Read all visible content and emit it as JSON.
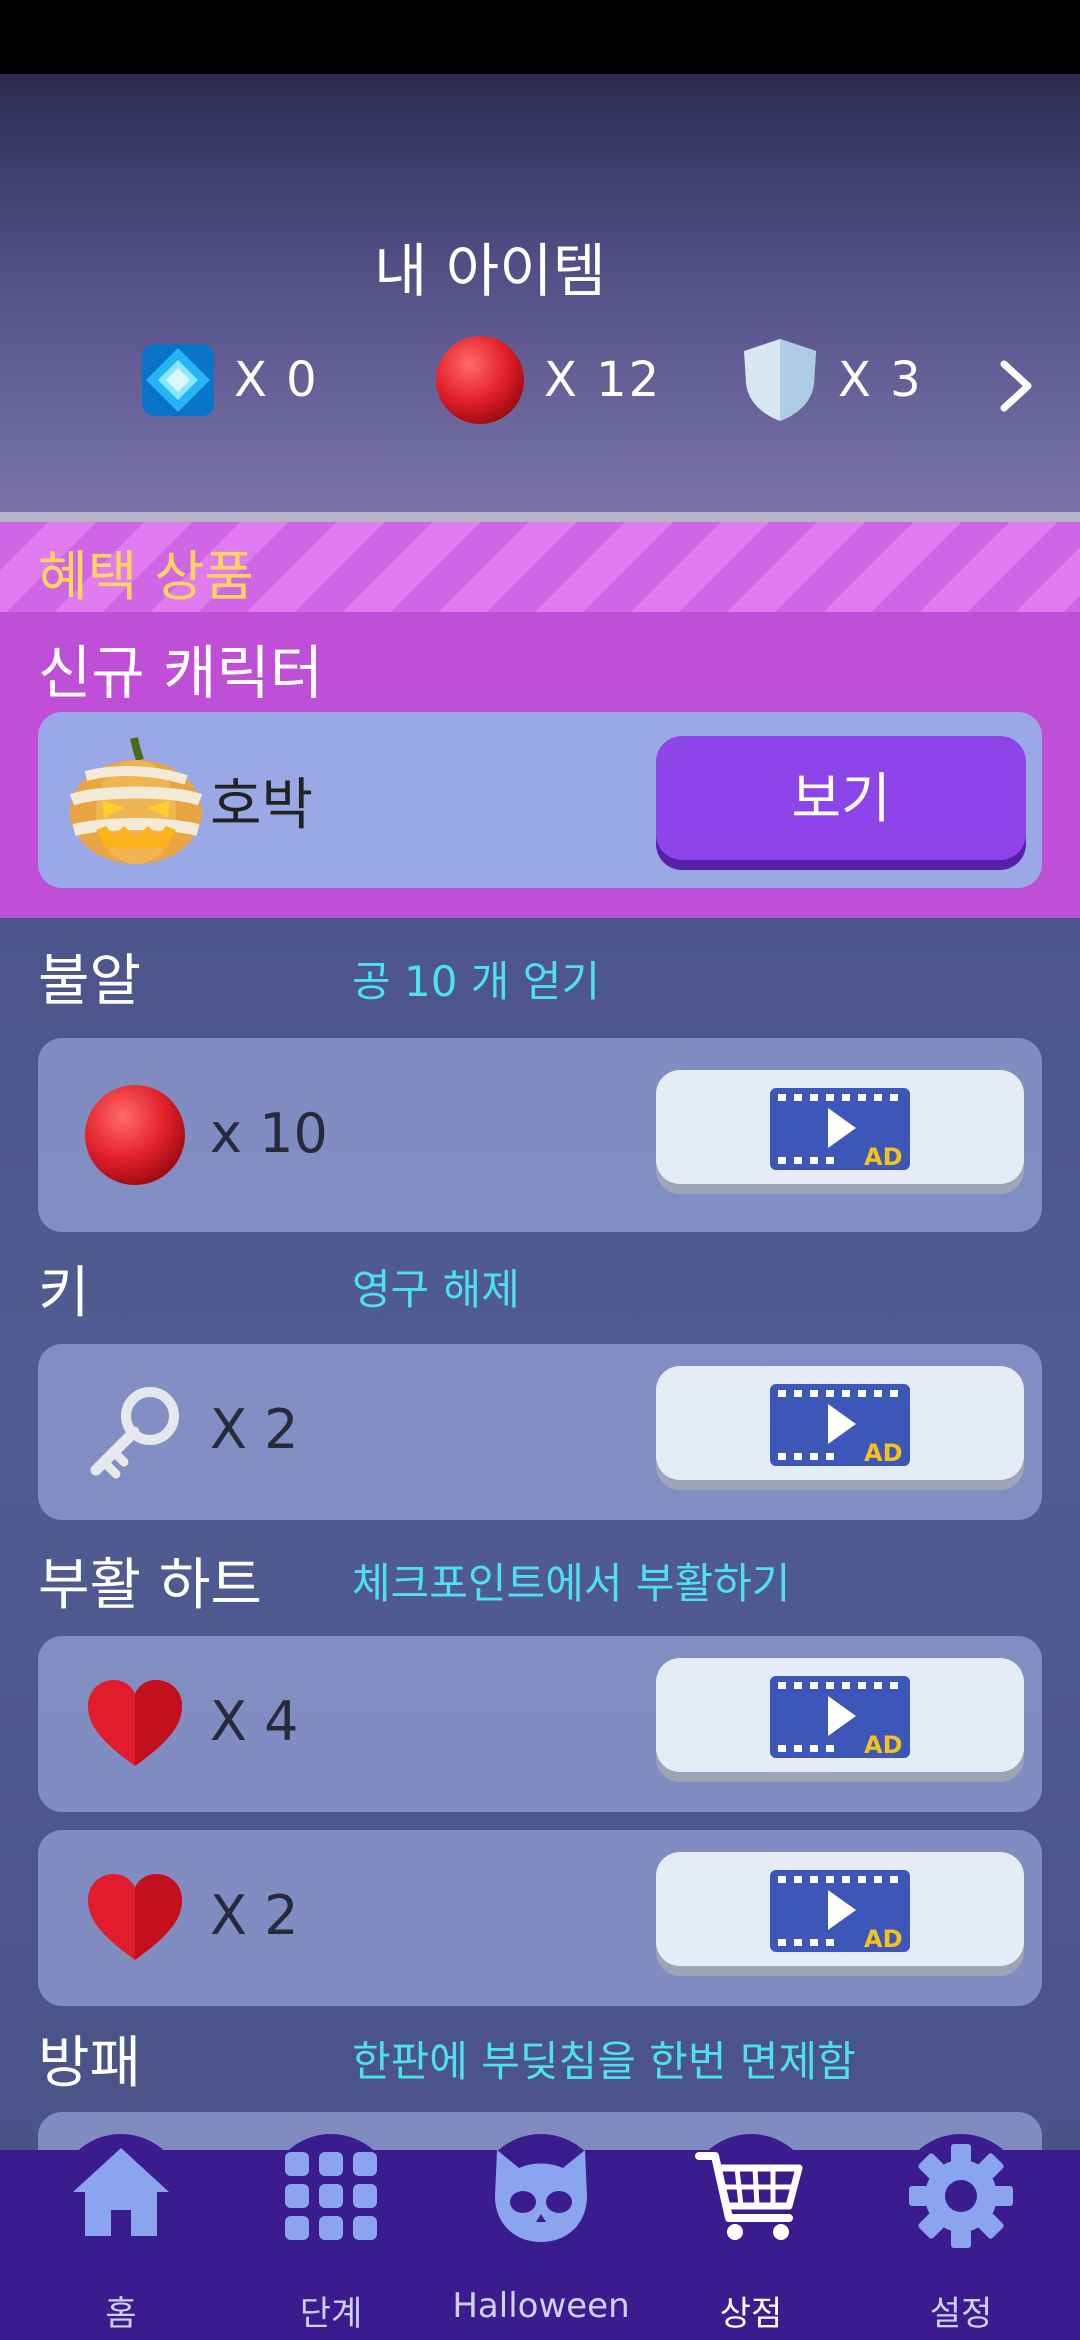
{
  "header": {
    "title": "내 아이템",
    "inventory": [
      {
        "icon": "gem-icon",
        "count": "X 0"
      },
      {
        "icon": "red-ball-icon",
        "count": "X 12"
      },
      {
        "icon": "shield-icon",
        "count": "X 3"
      }
    ]
  },
  "promo": {
    "banner": "혜택 상품",
    "subtitle": "신규 캐릭터",
    "character_name": "호박",
    "view_button": "보기"
  },
  "sections": [
    {
      "title": "불알",
      "desc": "공 10 개 얻기",
      "cards": [
        {
          "icon": "red-ball-icon",
          "count": "x 10"
        }
      ]
    },
    {
      "title": "키",
      "desc": "영구 해제",
      "cards": [
        {
          "icon": "key-icon",
          "count": "X 2"
        }
      ]
    },
    {
      "title": "부활 하트",
      "desc": "체크포인트에서 부활하기",
      "cards": [
        {
          "icon": "heart-icon",
          "count": "X 4"
        },
        {
          "icon": "heart-icon",
          "count": "X 2"
        }
      ]
    },
    {
      "title": "방패",
      "desc": "한판에 부딪침을 한번 면제함"
    }
  ],
  "ad_label": "AD",
  "nav": [
    {
      "label": "홈",
      "icon": "home-icon"
    },
    {
      "label": "단계",
      "icon": "grid-icon"
    },
    {
      "label": "Halloween",
      "icon": "cat-skull-icon"
    },
    {
      "label": "상점",
      "icon": "cart-icon",
      "active": true
    },
    {
      "label": "설정",
      "icon": "gear-icon"
    }
  ],
  "colors": {
    "accent_purple": "#8d45ea",
    "promo_banner": "#ffd65e",
    "desc_cyan": "#4ee0f0",
    "nav_bg": "#3a1c8f"
  }
}
